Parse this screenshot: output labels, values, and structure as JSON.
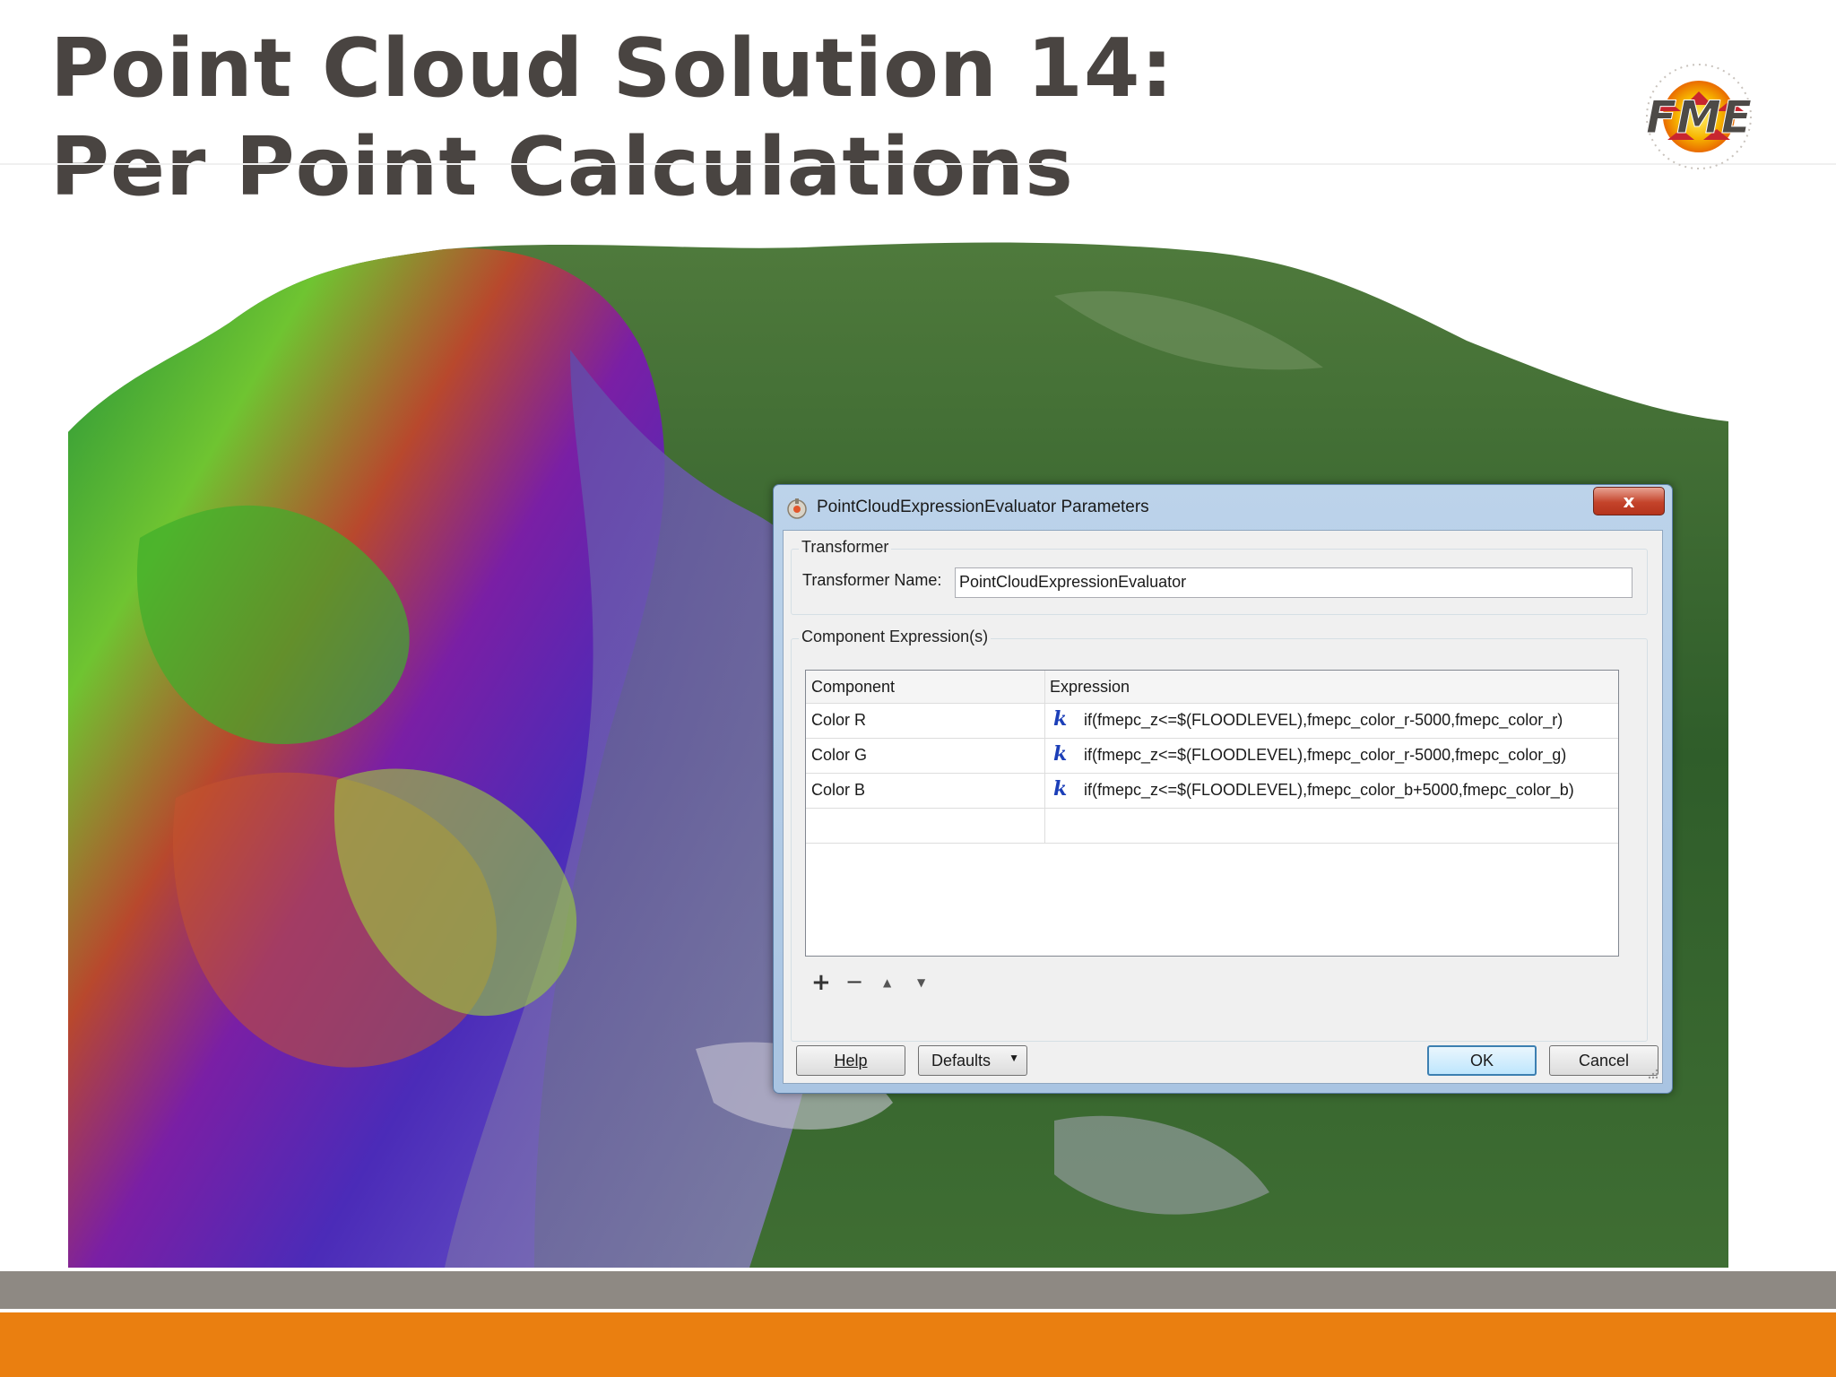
{
  "slide": {
    "title_line1": "Point Cloud Solution 14:",
    "title_line2": "Per Point Calculations"
  },
  "logo": {
    "text": "FME",
    "icon": "fme-logo"
  },
  "colors": {
    "title": "#494441",
    "footer_gray": "#8e8983",
    "footer_orange": "#ea7f10",
    "dialog_frame": "#a9c4e2",
    "close_button": "#c4432a"
  },
  "dialog": {
    "title": "PointCloudExpressionEvaluator Parameters",
    "close_label": "x",
    "transformer_group": {
      "legend": "Transformer",
      "name_label": "Transformer Name:",
      "name_value": "PointCloudExpressionEvaluator"
    },
    "expressions_group": {
      "legend": "Component Expression(s)",
      "columns": [
        "Component",
        "Expression"
      ],
      "rows": [
        {
          "component": "Color R",
          "expression": "if(fmepc_z<=$(FLOODLEVEL),fmepc_color_r-5000,fmepc_color_r)"
        },
        {
          "component": "Color G",
          "expression": "if(fmepc_z<=$(FLOODLEVEL),fmepc_color_r-5000,fmepc_color_g)"
        },
        {
          "component": "Color B",
          "expression": "if(fmepc_z<=$(FLOODLEVEL),fmepc_color_b+5000,fmepc_color_b)"
        }
      ],
      "toolbar": {
        "add": "+",
        "remove": "−",
        "up": "▲",
        "down": "▼"
      }
    },
    "buttons": {
      "help": "Help",
      "defaults": "Defaults",
      "ok": "OK",
      "cancel": "Cancel"
    }
  }
}
